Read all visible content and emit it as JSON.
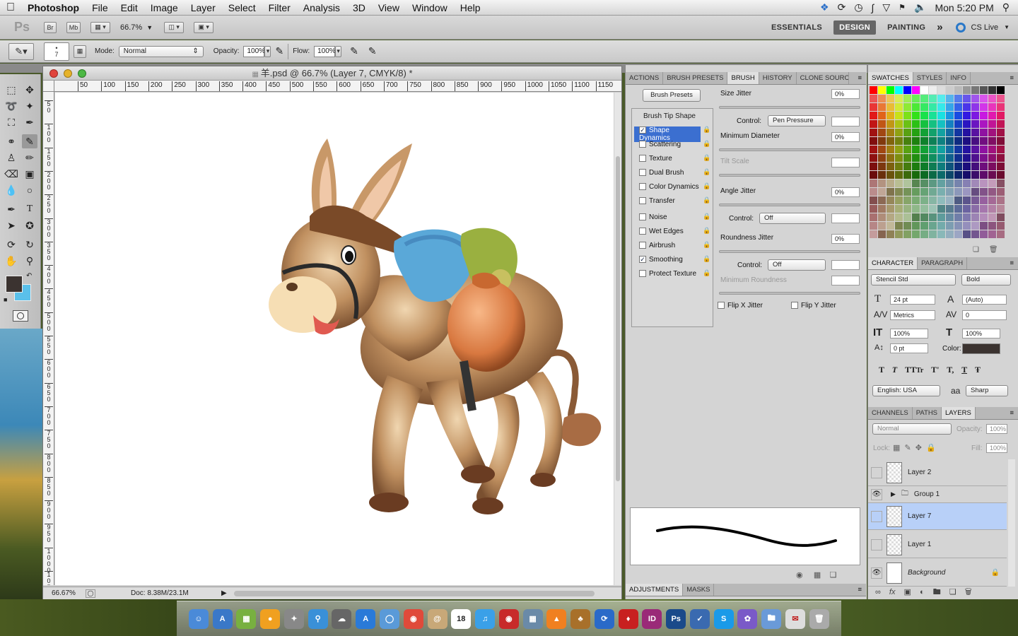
{
  "menubar": {
    "apple": "",
    "app": "Photoshop",
    "items": [
      "File",
      "Edit",
      "Image",
      "Layer",
      "Select",
      "Filter",
      "Analysis",
      "3D",
      "View",
      "Window",
      "Help"
    ],
    "clock": "Mon 5:20 PM"
  },
  "appbar": {
    "ps": "Ps",
    "br": "Br",
    "mb": "Mb",
    "zoom": "66.7%",
    "workspaces": [
      "ESSENTIALS",
      "DESIGN",
      "PAINTING"
    ],
    "more": "»",
    "cslive": "CS Live"
  },
  "options": {
    "brush_size": "7",
    "mode_label": "Mode:",
    "mode": "Normal",
    "opacity_label": "Opacity:",
    "opacity": "100%",
    "flow_label": "Flow:",
    "flow": "100%"
  },
  "document": {
    "title": "羊.psd @ 66.7% (Layer 7, CMYK/8) *",
    "ruler_h": [
      "50",
      "100",
      "150",
      "200",
      "250",
      "300",
      "350",
      "400",
      "450",
      "500",
      "550",
      "600",
      "650",
      "700",
      "750",
      "800",
      "850",
      "900",
      "950",
      "1000",
      "1050",
      "1100",
      "1150"
    ],
    "ruler_v": [
      "50",
      "100",
      "150",
      "200",
      "250",
      "300",
      "350",
      "400",
      "450",
      "500",
      "550",
      "600",
      "650",
      "700",
      "750",
      "800",
      "850",
      "900",
      "950",
      "1000",
      "1050"
    ],
    "zoom": "66.67%",
    "doc": "Doc: 8.38M/23.1M"
  },
  "brush_panel": {
    "tabs": [
      "ACTIONS",
      "BRUSH PRESETS",
      "BRUSH",
      "HISTORY",
      "CLONE SOURCE"
    ],
    "presets_button": "Brush Presets",
    "tip_shape": "Brush Tip Shape",
    "options": [
      {
        "label": "Shape Dynamics",
        "checked": true
      },
      {
        "label": "Scattering",
        "checked": false
      },
      {
        "label": "Texture",
        "checked": false
      },
      {
        "label": "Dual Brush",
        "checked": false
      },
      {
        "label": "Color Dynamics",
        "checked": false
      },
      {
        "label": "Transfer",
        "checked": false
      },
      {
        "label": "Noise",
        "checked": false
      },
      {
        "label": "Wet Edges",
        "checked": false
      },
      {
        "label": "Airbrush",
        "checked": false
      },
      {
        "label": "Smoothing",
        "checked": true
      },
      {
        "label": "Protect Texture",
        "checked": false
      }
    ],
    "size_jitter": "Size Jitter",
    "size_jitter_val": "0%",
    "control": "Control:",
    "control1": "Pen Pressure",
    "min_diameter": "Minimum Diameter",
    "min_diameter_val": "0%",
    "tilt_scale": "Tilt Scale",
    "angle_jitter": "Angle Jitter",
    "angle_jitter_val": "0%",
    "control2": "Off",
    "roundness_jitter": "Roundness Jitter",
    "roundness_jitter_val": "0%",
    "control3": "Off",
    "min_roundness": "Minimum Roundness",
    "flip_x": "Flip X Jitter",
    "flip_y": "Flip Y Jitter",
    "bottom_tabs": [
      "ADJUSTMENTS",
      "MASKS"
    ]
  },
  "swatches": {
    "tabs": [
      "SWATCHES",
      "STYLES",
      "INFO"
    ]
  },
  "character": {
    "tabs": [
      "CHARACTER",
      "PARAGRAPH"
    ],
    "font": "Stencil Std",
    "style": "Bold",
    "size": "24 pt",
    "leading": "(Auto)",
    "kerning": "Metrics",
    "tracking": "0",
    "vscale": "100%",
    "hscale": "100%",
    "baseline": "0 pt",
    "color_label": "Color:",
    "lang": "English: USA",
    "aa_icon": "aa",
    "aa": "Sharp",
    "styles": [
      "T",
      "T",
      "TT",
      "Tr",
      "T'",
      "T,",
      "T",
      "Ŧ"
    ]
  },
  "layers": {
    "tabs": [
      "CHANNELS",
      "PATHS",
      "LAYERS"
    ],
    "blend": "Normal",
    "opacity_label": "Opacity:",
    "opacity": "100%",
    "lock_label": "Lock:",
    "fill_label": "Fill:",
    "fill": "100%",
    "items": [
      {
        "name": "Layer 2",
        "visible": false,
        "selected": false
      },
      {
        "name": "Group 1",
        "visible": true,
        "selected": false
      },
      {
        "name": "Layer 7",
        "visible": false,
        "selected": true
      },
      {
        "name": "Layer 1",
        "visible": false,
        "selected": false
      },
      {
        "name": "Background",
        "visible": true,
        "selected": false
      }
    ]
  },
  "dock": {
    "calendar_day": "18",
    "id": "ID",
    "ps": "Ps"
  },
  "colors": {
    "accent": "#3b6fd0",
    "selected_layer": "#b8d0f8",
    "fg": "#3b3330",
    "bg": "#5ac0ea"
  }
}
